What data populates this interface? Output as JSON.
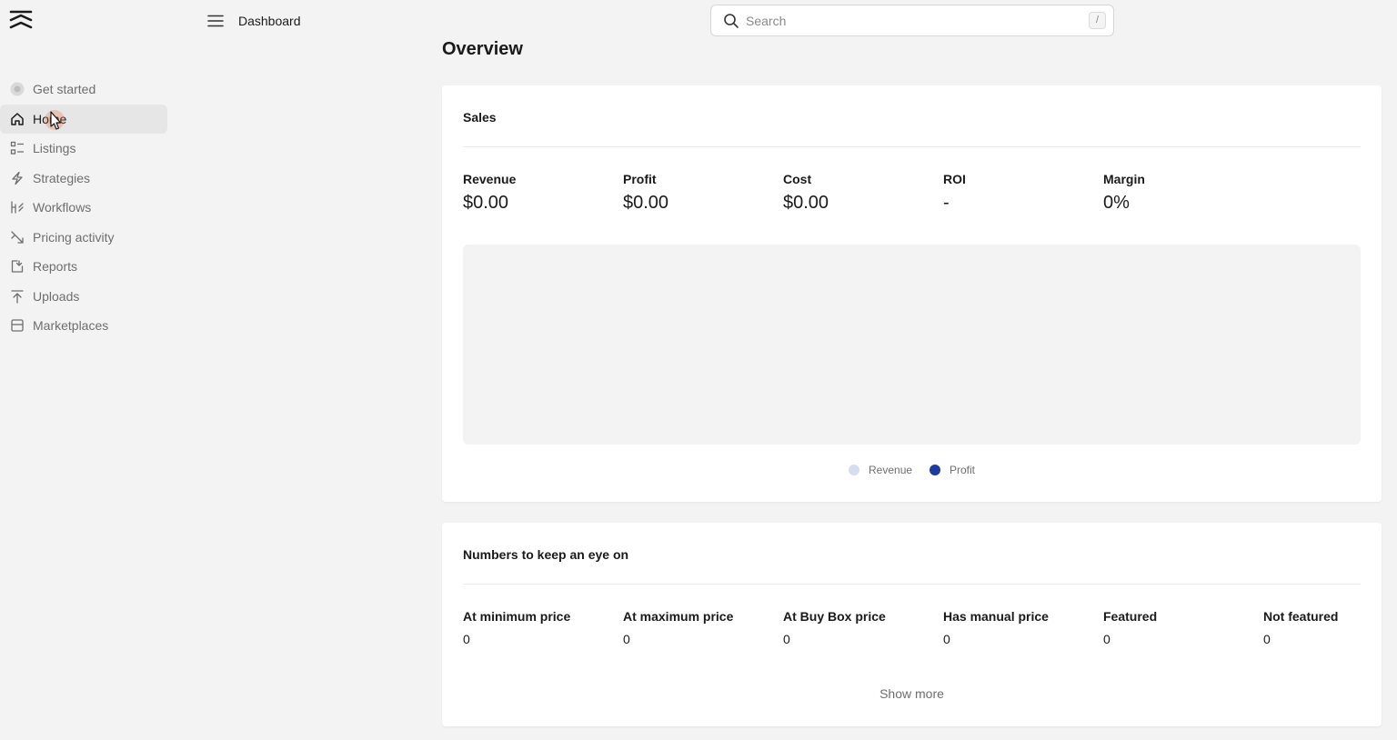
{
  "header": {
    "breadcrumb": "Dashboard",
    "search": {
      "placeholder": "Search",
      "shortcut": "/"
    }
  },
  "sidebar": {
    "items": [
      {
        "label": "Get started",
        "icon": "circle-progress-icon"
      },
      {
        "label": "Home",
        "icon": "home-icon",
        "active": true
      },
      {
        "label": "Listings",
        "icon": "list-icon"
      },
      {
        "label": "Strategies",
        "icon": "bolt-icon"
      },
      {
        "label": "Workflows",
        "icon": "workflow-icon"
      },
      {
        "label": "Pricing activity",
        "icon": "arrows-icon"
      },
      {
        "label": "Reports",
        "icon": "report-icon"
      },
      {
        "label": "Uploads",
        "icon": "upload-icon"
      },
      {
        "label": "Marketplaces",
        "icon": "store-icon"
      }
    ]
  },
  "main": {
    "title": "Overview",
    "sales": {
      "title": "Sales",
      "metrics": [
        {
          "label": "Revenue",
          "value": "$0.00"
        },
        {
          "label": "Profit",
          "value": "$0.00"
        },
        {
          "label": "Cost",
          "value": "$0.00"
        },
        {
          "label": "ROI",
          "value": "-"
        },
        {
          "label": "Margin",
          "value": "0%"
        }
      ],
      "legend": [
        {
          "label": "Revenue",
          "color": "#d6dcf2"
        },
        {
          "label": "Profit",
          "color": "#1f3a9e"
        }
      ]
    },
    "numbers": {
      "title": "Numbers to keep an eye on",
      "stats": [
        {
          "label": "At minimum price",
          "value": "0"
        },
        {
          "label": "At maximum price",
          "value": "0"
        },
        {
          "label": "At Buy Box price",
          "value": "0"
        },
        {
          "label": "Has manual price",
          "value": "0"
        },
        {
          "label": "Featured",
          "value": "0"
        },
        {
          "label": "Not featured",
          "value": "0"
        }
      ],
      "show_more": "Show more"
    }
  },
  "colors": {
    "background": "#f3f3f3",
    "card": "#ffffff",
    "active_nav": "#e6e6e6",
    "cursor": "#e8673a"
  }
}
